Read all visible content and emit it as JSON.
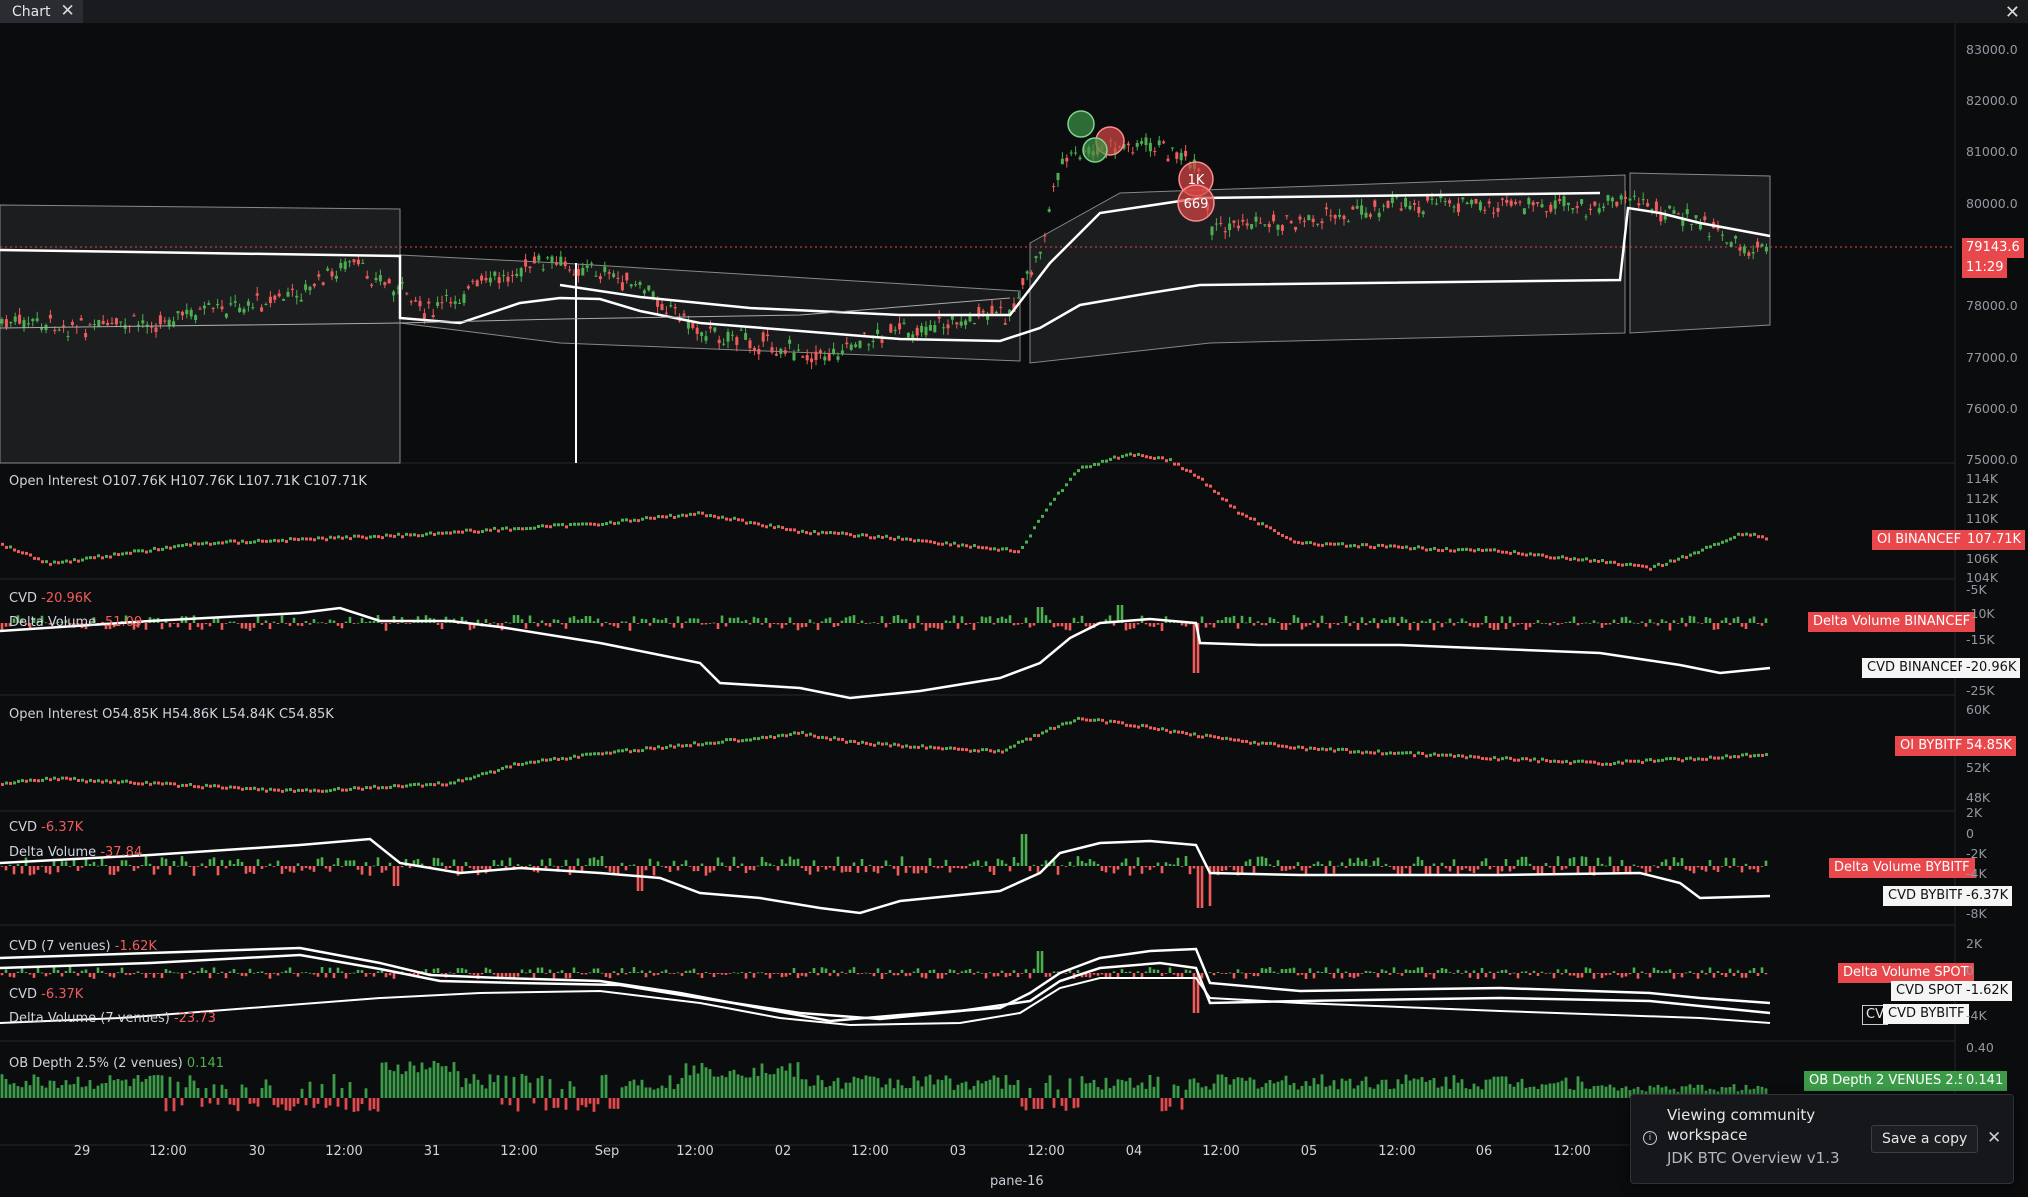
{
  "window": {
    "tab_label": "Chart"
  },
  "colors": {
    "up": "#4caf50",
    "down": "#f05c5c",
    "line": "#ffffff",
    "bg": "#0b0c0e",
    "tag_red": "#e8484c",
    "tag_green": "#3b9b48"
  },
  "icons": {
    "tab_close": "close-icon",
    "window_close": "close-icon",
    "notice_info": "info-icon"
  },
  "price_pane": {
    "last_price": "79143.6",
    "countdown": "11:29",
    "axis_ticks": [
      "83000.0",
      "82000.0",
      "81000.0",
      "80000.0",
      "78000.0",
      "77000.0",
      "76000.0",
      "75000.0"
    ],
    "markers": [
      "1K",
      "669"
    ]
  },
  "panes": {
    "oi_binance": {
      "label": "Open Interest",
      "ohlc": "O107.76K  H107.76K  L107.71K  C107.71K",
      "tag_name": "OI BINANCEF",
      "tag_value": "107.71K",
      "axis_ticks": [
        "114K",
        "112K",
        "110K",
        "106K",
        "104K"
      ]
    },
    "cvd_binance": {
      "cvd_label": "CVD",
      "cvd_value": "-20.96K",
      "dv_label": "Delta Volume",
      "dv_value": "-51.09",
      "dv_tag": "Delta Volume BINANCEF",
      "cvd_tag_name": "CVD BINANCEF",
      "cvd_tag_value": "-20.96K",
      "axis_ticks": [
        "-5K",
        "-10K",
        "-15K",
        "-25K"
      ]
    },
    "oi_bybit": {
      "label": "Open Interest",
      "ohlc": "O54.85K  H54.86K  L54.84K  C54.85K",
      "tag_name": "OI BYBITF",
      "tag_value": "54.85K",
      "axis_ticks": [
        "60K",
        "52K",
        "48K"
      ]
    },
    "cvd_bybit": {
      "cvd_label": "CVD",
      "cvd_value": "-6.37K",
      "dv_label": "Delta Volume",
      "dv_value": "-37.84",
      "dv_tag": "Delta Volume BYBITF",
      "cvd_tag_name": "CVD BYBITF",
      "cvd_tag_value": "-6.37K",
      "axis_ticks": [
        "2K",
        "0",
        "-2K",
        "-4K",
        "-8K"
      ]
    },
    "spot": {
      "cvd7_label": "CVD (7 venues)",
      "cvd7_value": "-1.62K",
      "cvd2_label": "CVD",
      "cvd2_value": "-6.37K",
      "dv_label": "Delta Volume (7 venues)",
      "dv_value": "-23.73",
      "dv_tag": "Delta Volume SPOT",
      "cvd_spot_tag": "CVD SPOT",
      "cvd_spot_value": "-1.62K",
      "cvd_bybit_tag": "CVD BYBITF",
      "cv_stub": "CV",
      "axis_ticks": [
        "2K",
        "0",
        "-4K"
      ]
    },
    "obdepth": {
      "label": "OB Depth 2.5% (2 venues)",
      "value": "0.141",
      "tag_name": "OB Depth 2 VENUES 2.5%",
      "tag_value": "0.141",
      "axis_ticks": [
        "0.40"
      ]
    }
  },
  "time_axis": [
    "29",
    "12:00",
    "30",
    "12:00",
    "31",
    "12:00",
    "Sep",
    "12:00",
    "02",
    "12:00",
    "03",
    "12:00",
    "04",
    "12:00",
    "05",
    "12:00",
    "06",
    "12:00"
  ],
  "footer": {
    "pane_name": "pane-16"
  },
  "notice": {
    "title": "Viewing community workspace",
    "workspace": "JDK BTC Overview v1.3",
    "save_label": "Save a copy"
  }
}
